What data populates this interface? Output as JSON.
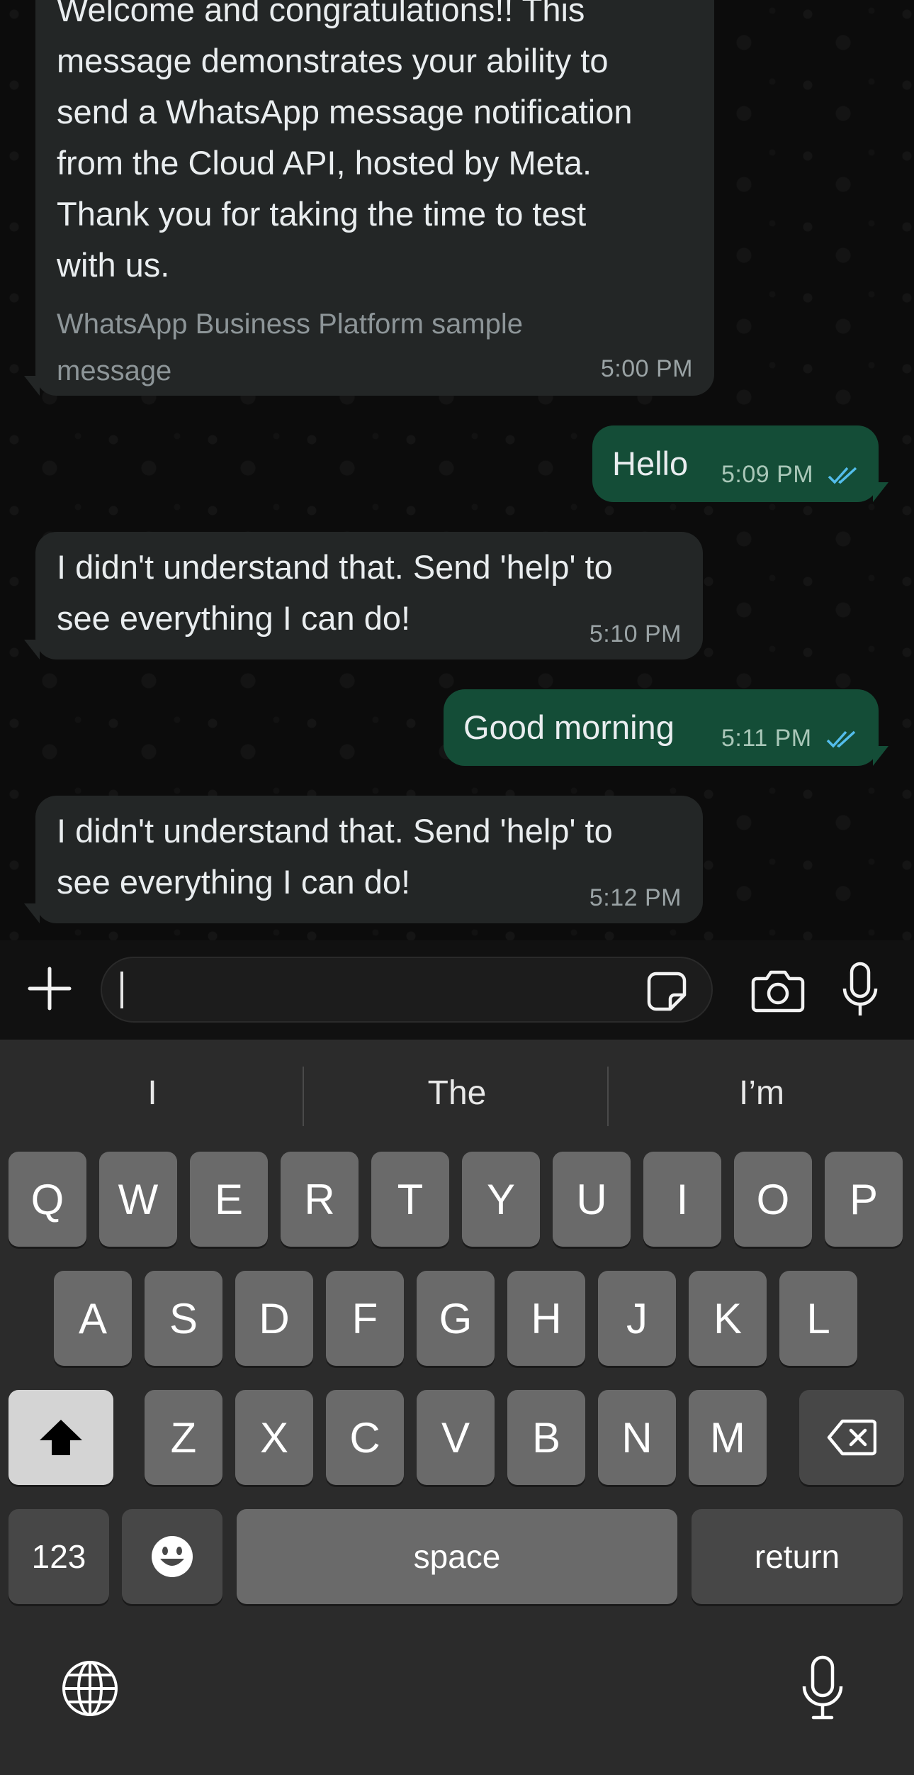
{
  "messages": [
    {
      "direction": "incoming",
      "text": "Welcome and congratulations!! This message demonstrates your ability to send a WhatsApp message notification from the Cloud API, hosted by Meta. Thank you for taking the time to test with us.",
      "lines": [
        "Welcome and congratulations!! This",
        "message demonstrates your ability to",
        "send a WhatsApp message notification",
        "from the Cloud API, hosted by Meta.",
        "Thank you for taking the time to test",
        "with us."
      ],
      "footer_lines": [
        "WhatsApp Business Platform sample",
        "message"
      ],
      "time": "5:00 PM"
    },
    {
      "direction": "outgoing",
      "text": "Hello",
      "time": "5:09 PM",
      "status": "read"
    },
    {
      "direction": "incoming",
      "lines": [
        "I didn't understand that. Send 'help' to",
        "see everything I can do!"
      ],
      "time": "5:10 PM"
    },
    {
      "direction": "outgoing",
      "text": "Good morning",
      "time": "5:11 PM",
      "status": "read"
    },
    {
      "direction": "incoming",
      "lines": [
        "I didn't understand that. Send 'help' to",
        "see everything I can do!"
      ],
      "time": "5:12 PM"
    }
  ],
  "composer": {
    "value": "",
    "icons": [
      "plus-icon",
      "sticker-icon",
      "camera-icon",
      "microphone-icon"
    ]
  },
  "keyboard": {
    "suggestions": [
      "I",
      "The",
      "I’m"
    ],
    "row1": [
      "Q",
      "W",
      "E",
      "R",
      "T",
      "Y",
      "U",
      "I",
      "O",
      "P"
    ],
    "row2": [
      "A",
      "S",
      "D",
      "F",
      "G",
      "H",
      "J",
      "K",
      "L"
    ],
    "row3": [
      "Z",
      "X",
      "C",
      "V",
      "B",
      "N",
      "M"
    ],
    "numbers_label": "123",
    "space_label": "space",
    "return_label": "return",
    "icons": [
      "shift-icon",
      "backspace-icon",
      "emoji-icon",
      "globe-icon",
      "dictation-mic-icon"
    ]
  },
  "colors": {
    "incoming_bubble": "#232626",
    "outgoing_bubble": "#144d37",
    "read_ticks": "#53bdeb"
  }
}
